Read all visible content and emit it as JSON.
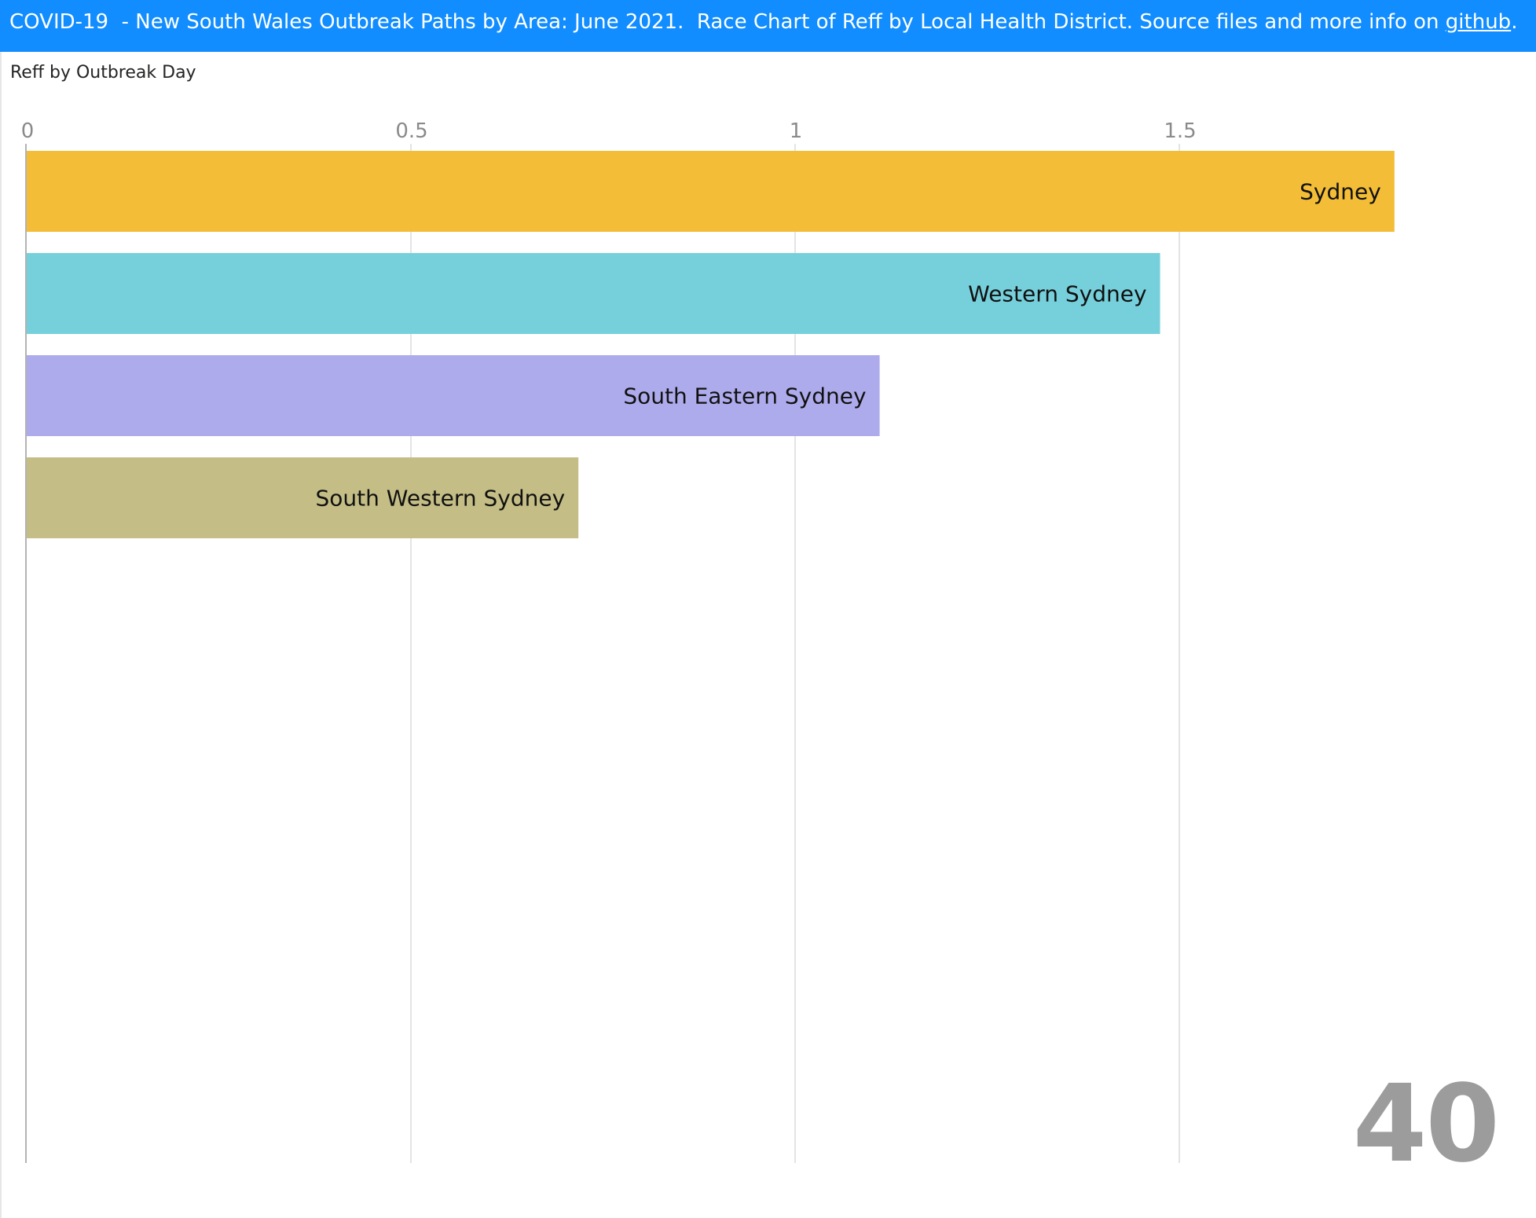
{
  "header": {
    "title_text": "COVID-19  - New South Wales Outbreak Paths by Area: June 2021.  Race Chart of Reff by Local Health District. Source files and more info on ",
    "link_text": "github",
    "suffix": ".",
    "background_color": "#118dff"
  },
  "chart_data": {
    "type": "bar",
    "orientation": "horizontal",
    "title": "Reff by Outbreak Day",
    "categories": [
      "Sydney",
      "Western Sydney",
      "South Eastern Sydney",
      "South Western Sydney"
    ],
    "values": [
      1.78,
      1.475,
      1.11,
      0.718
    ],
    "colors": [
      "#f3bd37",
      "#76d0db",
      "#aeabec",
      "#c4be86"
    ],
    "xlim": [
      0,
      1.8
    ],
    "x_ticks": [
      0,
      0.5,
      1,
      1.5
    ],
    "x_tick_labels": [
      "0",
      "0.5",
      "1",
      "1.5"
    ],
    "grid": true,
    "period_label": "40"
  }
}
